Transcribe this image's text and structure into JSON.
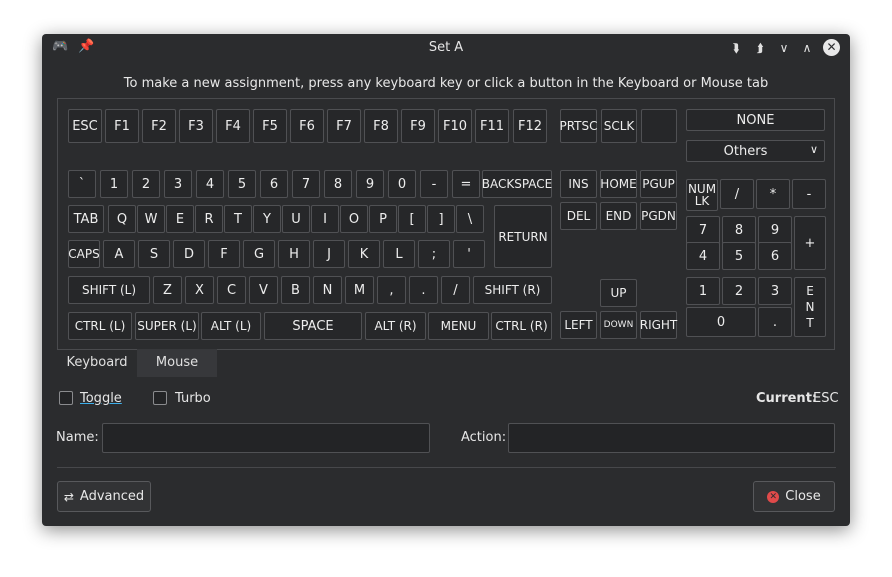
{
  "window": {
    "title": "Set A",
    "icons": {
      "app": "gamepad-icon",
      "pin": "pin-icon"
    },
    "controls": [
      "double-down-icon",
      "double-up-icon",
      "chevron-down-icon",
      "chevron-up-icon",
      "close-icon"
    ]
  },
  "instruction": "To make a new assignment, press any keyboard key or click a button in the Keyboard or Mouse tab",
  "keyboard": {
    "function_row": [
      "ESC",
      "F1",
      "F2",
      "F3",
      "F4",
      "F5",
      "F6",
      "F7",
      "F8",
      "F9",
      "F10",
      "F11",
      "F12"
    ],
    "system_keys": [
      "PRTSC",
      "SCLK",
      ""
    ],
    "number_row": [
      "`",
      "1",
      "2",
      "3",
      "4",
      "5",
      "6",
      "7",
      "8",
      "9",
      "0",
      "-",
      "=",
      "BACKSPACE"
    ],
    "tab_row": [
      "TAB",
      "Q",
      "W",
      "E",
      "R",
      "T",
      "Y",
      "U",
      "I",
      "O",
      "P",
      "[",
      "]",
      "\\"
    ],
    "caps_row": [
      "CAPS",
      "A",
      "S",
      "D",
      "F",
      "G",
      "H",
      "J",
      "K",
      "L",
      ";",
      "'"
    ],
    "return_key": "RETURN",
    "shift_row": [
      "SHIFT (L)",
      "Z",
      "X",
      "C",
      "V",
      "B",
      "N",
      "M",
      ",",
      ".",
      "/",
      "SHIFT (R)"
    ],
    "bottom_row": [
      "CTRL (L)",
      "SUPER (L)",
      "ALT (L)",
      "SPACE",
      "ALT (R)",
      "MENU",
      "CTRL (R)"
    ],
    "nav_keys": [
      "INS",
      "HOME",
      "PGUP",
      "DEL",
      "END",
      "PGDN"
    ],
    "arrow_keys": [
      "UP",
      "LEFT",
      "DOWN",
      "RIGHT"
    ],
    "numpad": {
      "numlock": "NUM LK",
      "top": [
        "/",
        "*",
        "-"
      ],
      "row7": [
        "7",
        "8",
        "9"
      ],
      "row4": [
        "4",
        "5",
        "6"
      ],
      "plus": "+",
      "row1": [
        "1",
        "2",
        "3"
      ],
      "zero": "0",
      "dot": ".",
      "enter": "E N T"
    },
    "none_button": "NONE",
    "others_select": "Others"
  },
  "tabs": [
    "Keyboard",
    "Mouse"
  ],
  "options": {
    "toggle": "Toggle",
    "turbo": "Turbo",
    "current_label": "Current:",
    "current_value": "ESC"
  },
  "fields": {
    "name_label": "Name:",
    "name_value": "",
    "action_label": "Action:",
    "action_value": ""
  },
  "buttons": {
    "advanced": "Advanced",
    "close": "Close"
  }
}
